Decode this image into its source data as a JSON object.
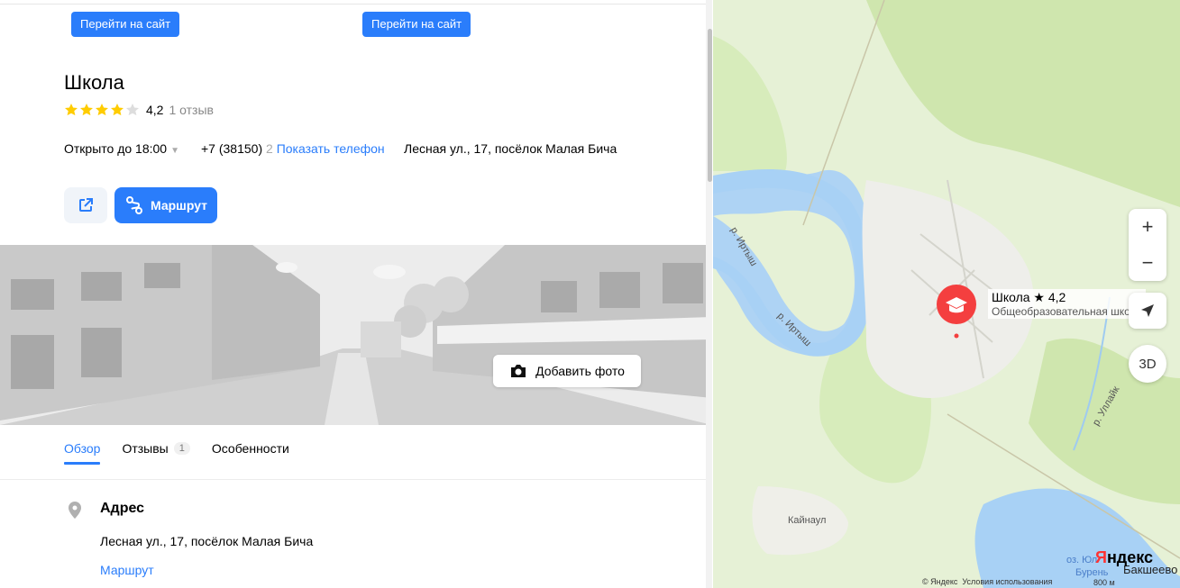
{
  "top_buttons": [
    "Перейти на сайт",
    "Перейти на сайт"
  ],
  "org": {
    "title": "Школа",
    "rating": "4,2",
    "rating_value": 4.2,
    "reviews": "1 отзыв",
    "hours": "Открыто до 18:00",
    "phone_prefix": "+7 (38150)",
    "phone_hidden": "2",
    "phone_link": "Показать телефон",
    "address": "Лесная ул., 17, посёлок Малая Бича"
  },
  "actions": {
    "route": "Маршрут"
  },
  "photo": {
    "add_label": "Добавить фото"
  },
  "tabs": [
    {
      "label": "Обзор"
    },
    {
      "label": "Отзывы",
      "badge": "1"
    },
    {
      "label": "Особенности"
    }
  ],
  "address_section": {
    "title": "Адрес",
    "text": "Лесная ул., 17, посёлок Малая Бича",
    "route": "Маршрут"
  },
  "map": {
    "pin_name": "Школа ★ 4,2",
    "pin_category": "Общеобразовательная школа",
    "labels": {
      "river1": "р. Иртыш",
      "river2": "р. Иртыш",
      "river3": "р. Уллайк",
      "village1": "Кайнаул",
      "village2": "Бакшеево",
      "lake": "оз. Юл",
      "lake2": "Бурень"
    },
    "logo": "Яндекс",
    "copyright": "© Яндекс",
    "terms": "Условия использования",
    "scale": "800 м",
    "controls": {
      "zoom_in": "+",
      "zoom_out": "−",
      "btn3d": "3D"
    }
  },
  "colors": {
    "accent": "#2a7dfb",
    "pin": "#f43f3f",
    "water": "#a8d1f5",
    "forest": "#cfe8ae"
  }
}
